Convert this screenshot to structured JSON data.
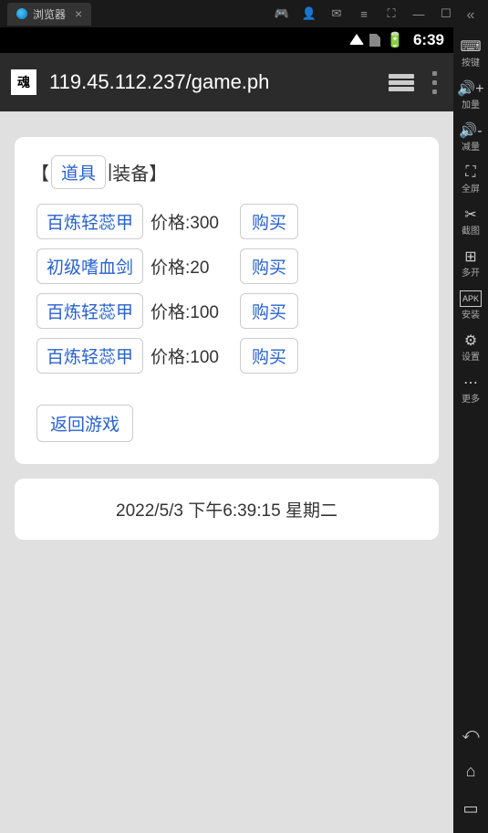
{
  "window": {
    "tab_title": "浏览器"
  },
  "sidebar": {
    "items": [
      {
        "icon": "⌨",
        "label": "按键"
      },
      {
        "icon": "🔊+",
        "label": "加量"
      },
      {
        "icon": "🔊-",
        "label": "减量"
      },
      {
        "icon": "⛶",
        "label": "全屏"
      },
      {
        "icon": "✂",
        "label": "截图"
      },
      {
        "icon": "⊕",
        "label": "多开"
      },
      {
        "icon": "APK",
        "label": "安装"
      },
      {
        "icon": "⚙",
        "label": "设置"
      },
      {
        "icon": "⋯",
        "label": "更多"
      }
    ]
  },
  "status": {
    "time": "6:39"
  },
  "browser": {
    "url": "119.45.112.237/game.ph"
  },
  "shop": {
    "bracket_open": "【",
    "bracket_close": "】",
    "separator": "|",
    "cat_items": "道具",
    "cat_equip": "装备",
    "price_prefix": "价格:",
    "buy_label": "购买",
    "back_label": "返回游戏",
    "items": [
      {
        "name": "百炼轻蕊甲",
        "price": "300"
      },
      {
        "name": "初级嗜血剑",
        "price": "20"
      },
      {
        "name": "百炼轻蕊甲",
        "price": "100"
      },
      {
        "name": "百炼轻蕊甲",
        "price": "100"
      }
    ]
  },
  "footer": {
    "timestamp": "2022/5/3 下午6:39:15 星期二"
  }
}
